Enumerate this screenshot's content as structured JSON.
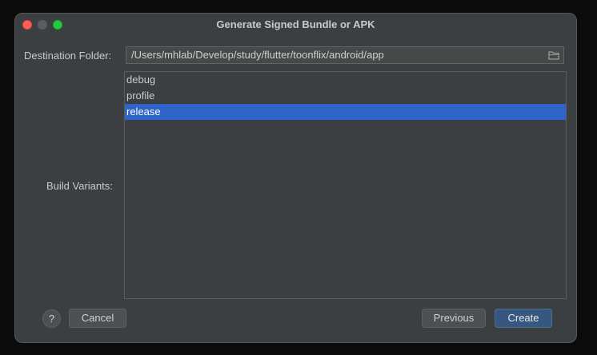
{
  "window": {
    "title": "Generate Signed Bundle or APK"
  },
  "destination": {
    "label": "Destination Folder:",
    "value": "/Users/mhlab/Develop/study/flutter/toonflix/android/app"
  },
  "build_variants": {
    "label": "Build Variants:",
    "items": [
      "debug",
      "profile",
      "release"
    ],
    "selected": "release"
  },
  "buttons": {
    "help": "?",
    "cancel": "Cancel",
    "previous": "Previous",
    "create": "Create"
  },
  "colors": {
    "selection": "#2f65ca",
    "primary_button": "#365880",
    "close": "#ff5f57",
    "maximize": "#28c840"
  }
}
